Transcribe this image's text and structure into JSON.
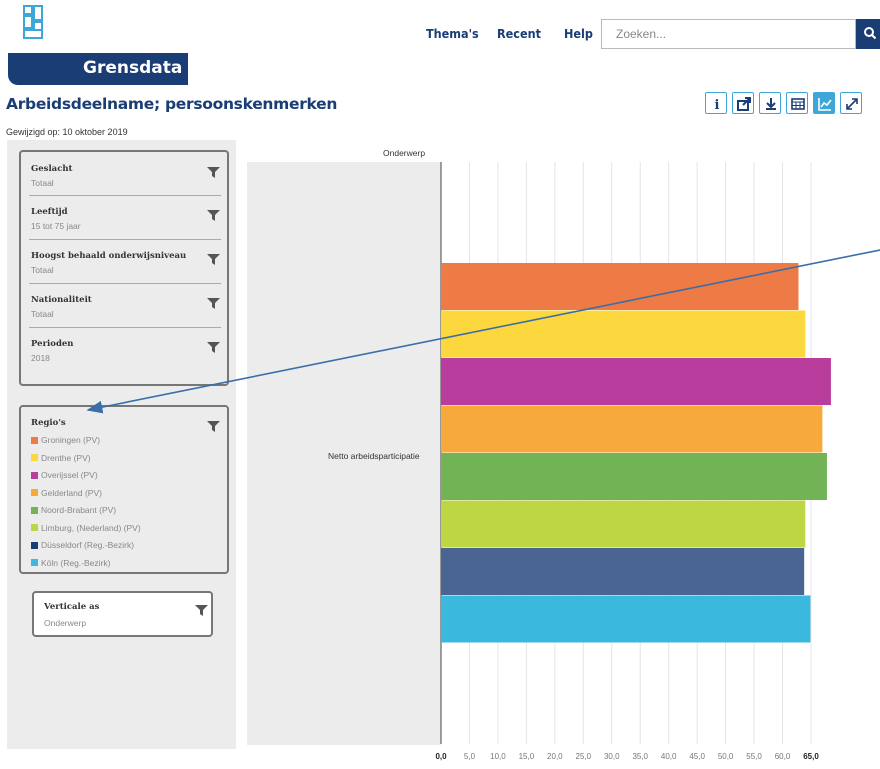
{
  "header": {
    "brand": "Grensdata",
    "logo_icon": "cbs-logo-icon",
    "nav": [
      "Thema's",
      "Recent",
      "Help"
    ],
    "search_placeholder": "Zoeken...",
    "search_icon": "search-icon"
  },
  "page": {
    "title": "Arbeidsdeelname; persoonskenmerken",
    "modified": "Gewijzigd op: 10 oktober 2019"
  },
  "toolbar": {
    "buttons": [
      "info-icon",
      "share-icon",
      "download-icon",
      "table-icon",
      "chart-icon",
      "expand-icon"
    ],
    "active": "chart-icon",
    "accent": "#3fa6d9"
  },
  "filters": [
    {
      "title": "Geslacht",
      "value": "Totaal"
    },
    {
      "title": "Leeftijd",
      "value": "15 tot 75 jaar"
    },
    {
      "title": "Hoogst behaald onderwijsniveau",
      "value": "Totaal"
    },
    {
      "title": "Nationaliteit",
      "value": "Totaal"
    },
    {
      "title": "Perioden",
      "value": "2018"
    }
  ],
  "regions": {
    "title": "Regio's",
    "items": [
      {
        "label": "Groningen (PV)",
        "color": "#ee7a45"
      },
      {
        "label": "Drenthe (PV)",
        "color": "#fcd83e"
      },
      {
        "label": "Overijssel (PV)",
        "color": "#b83d9d"
      },
      {
        "label": "Gelderland (PV)",
        "color": "#f7a93c"
      },
      {
        "label": "Noord-Brabant (PV)",
        "color": "#72b455"
      },
      {
        "label": "Limburg, (Nederland) (PV)",
        "color": "#bed544"
      },
      {
        "label": "Düsseldorf (Reg.-Bezirk)",
        "color": "#1a3d75"
      },
      {
        "label": "Köln (Reg.-Bezirk)",
        "color": "#3ab8de"
      }
    ]
  },
  "vertical_axis": {
    "title": "Verticale as",
    "value": "Onderwerp"
  },
  "chart_data": {
    "type": "bar",
    "orientation": "horizontal",
    "category_axis_title": "Onderwerp",
    "categories": [
      "Netto arbeidsparticipatie"
    ],
    "series": [
      {
        "name": "Groningen (PV)",
        "values": [
          62.8
        ],
        "color": "#ee7a45"
      },
      {
        "name": "Drenthe (PV)",
        "values": [
          64.0
        ],
        "color": "#fcd83e"
      },
      {
        "name": "Overijssel (PV)",
        "values": [
          68.5
        ],
        "color": "#b83d9d"
      },
      {
        "name": "Gelderland (PV)",
        "values": [
          67.0
        ],
        "color": "#f7a93c"
      },
      {
        "name": "Noord-Brabant (PV)",
        "values": [
          67.8
        ],
        "color": "#72b455"
      },
      {
        "name": "Limburg, (Nederland) (PV)",
        "values": [
          64.0
        ],
        "color": "#bed544"
      },
      {
        "name": "Düsseldorf (Reg.-Bezirk)",
        "values": [
          63.8
        ],
        "color": "#4a6591"
      },
      {
        "name": "Köln (Reg.-Bezirk)",
        "values": [
          64.9
        ],
        "color": "#3ab8de"
      }
    ],
    "xticks": [
      "0,0",
      "5,0",
      "10,0",
      "15,0",
      "20,0",
      "25,0",
      "30,0",
      "35,0",
      "40,0",
      "45,0",
      "50,0",
      "55,0",
      "60,0",
      "65,0"
    ],
    "xlim": [
      0,
      65
    ],
    "grid": true
  }
}
